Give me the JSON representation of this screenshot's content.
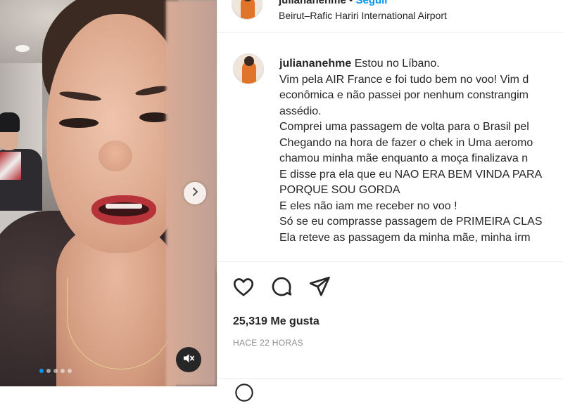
{
  "post": {
    "username": "juliananehme",
    "follow_label": "Seguir",
    "separator": "•",
    "location": "Beirut–Rafic Hariri International Airport"
  },
  "caption": {
    "username": "juliananehme",
    "first_line": "Estou no Líbano.",
    "lines": [
      "Vim pela AIR France e foi tudo bem no voo! Vim d",
      "econômica e não passei por nenhum constrangim",
      "assédio.",
      "Comprei uma passagem de volta para o Brasil pel",
      "Chegando na hora de fazer o chek in Uma aeromo",
      "chamou minha mãe enquanto a moça finalizava n",
      "E disse pra ela que eu NAO ERA BEM VINDA PARA",
      "PORQUE SOU GORDA",
      "E eles não iam me receber no voo !",
      "Só se eu comprasse passagem de PRIMEIRA CLAS",
      "Ela reteve as passagem da minha mãe, minha irm"
    ]
  },
  "engagement": {
    "likes": "25,319 Me gusta",
    "time": "HACE 22 HORAS"
  },
  "carousel": {
    "slides": 5,
    "active_index": 0
  },
  "icons": {
    "like": "heart-icon",
    "comment": "comment-icon",
    "share": "send-icon",
    "next": "chevron-right-icon",
    "mute": "speaker-muted-icon",
    "emoji": "emoji-icon"
  },
  "colors": {
    "accent": "#0095f6",
    "text": "#262626",
    "muted": "#8e8e8e"
  }
}
